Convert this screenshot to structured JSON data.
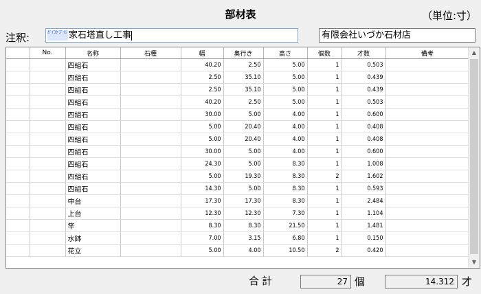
{
  "title": "部材表",
  "unit": "（単位:寸）",
  "note": {
    "label": "注釈:",
    "furigana": "ｶﾞｲｺｳ ｽﾞｲｼ",
    "value": "家石塔直し工事"
  },
  "company": "有限会社いづか石材店",
  "columns": [
    "No.",
    "名称",
    "石種",
    "幅",
    "奥行き",
    "高さ",
    "個数",
    "才数",
    "備考"
  ],
  "rows": [
    {
      "name": "四組石",
      "width": "40.20",
      "depth": "2.50",
      "height": "5.00",
      "qty": "1",
      "sai": "0.503"
    },
    {
      "name": "四組石",
      "width": "2.50",
      "depth": "35.10",
      "height": "5.00",
      "qty": "1",
      "sai": "0.439"
    },
    {
      "name": "四組石",
      "width": "2.50",
      "depth": "35.10",
      "height": "5.00",
      "qty": "1",
      "sai": "0.439"
    },
    {
      "name": "四組石",
      "width": "40.20",
      "depth": "2.50",
      "height": "5.00",
      "qty": "1",
      "sai": "0.503"
    },
    {
      "name": "四組石",
      "width": "30.00",
      "depth": "5.00",
      "height": "4.00",
      "qty": "1",
      "sai": "0.600"
    },
    {
      "name": "四組石",
      "width": "5.00",
      "depth": "20.40",
      "height": "4.00",
      "qty": "1",
      "sai": "0.408"
    },
    {
      "name": "四組石",
      "width": "5.00",
      "depth": "20.40",
      "height": "4.00",
      "qty": "1",
      "sai": "0.408"
    },
    {
      "name": "四組石",
      "width": "30.00",
      "depth": "5.00",
      "height": "4.00",
      "qty": "1",
      "sai": "0.600"
    },
    {
      "name": "四組石",
      "width": "24.30",
      "depth": "5.00",
      "height": "8.30",
      "qty": "1",
      "sai": "1.008"
    },
    {
      "name": "四組石",
      "width": "5.00",
      "depth": "19.30",
      "height": "8.30",
      "qty": "2",
      "sai": "1.602"
    },
    {
      "name": "四組石",
      "width": "14.30",
      "depth": "5.00",
      "height": "8.30",
      "qty": "1",
      "sai": "0.593"
    },
    {
      "name": "中台",
      "width": "17.30",
      "depth": "17.30",
      "height": "8.30",
      "qty": "1",
      "sai": "2.484"
    },
    {
      "name": "上台",
      "width": "12.30",
      "depth": "12.30",
      "height": "7.30",
      "qty": "1",
      "sai": "1.104"
    },
    {
      "name": "竿",
      "width": "8.30",
      "depth": "8.30",
      "height": "21.50",
      "qty": "1",
      "sai": "1.481"
    },
    {
      "name": "水鉢",
      "width": "7.00",
      "depth": "3.15",
      "height": "6.80",
      "qty": "1",
      "sai": "0.150"
    },
    {
      "name": "花立",
      "width": "5.00",
      "depth": "4.00",
      "height": "10.50",
      "qty": "2",
      "sai": "0.420"
    }
  ],
  "totals": {
    "label": "合計",
    "qty": "27",
    "qty_unit": "個",
    "sai": "14.312",
    "sai_unit": "才"
  }
}
